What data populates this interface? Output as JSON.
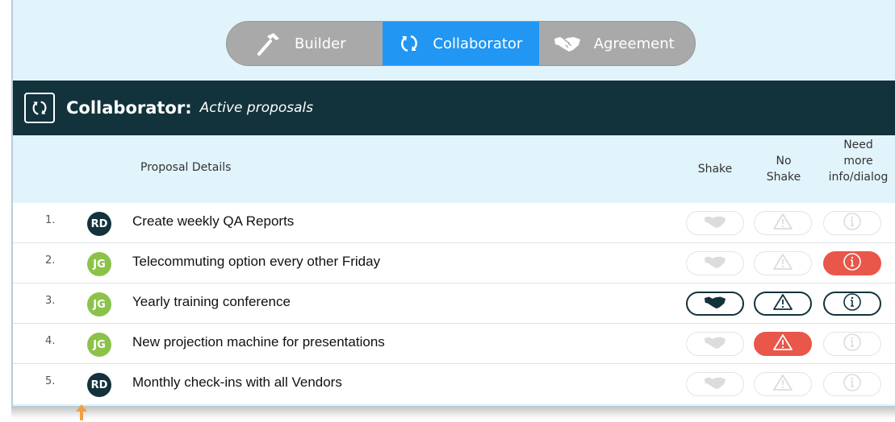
{
  "toolbar": {
    "tabs": [
      {
        "label": "Builder",
        "icon": "hammer-icon",
        "selected": false
      },
      {
        "label": "Collaborator",
        "icon": "sync-icon",
        "selected": true
      },
      {
        "label": "Agreement",
        "icon": "handshake-icon",
        "selected": false
      }
    ]
  },
  "header": {
    "title": "Collaborator:",
    "subtitle": "Active proposals",
    "icon": "sync-icon"
  },
  "columns": {
    "details": "Proposal Details",
    "shake": "Shake",
    "no_shake_1": "No",
    "no_shake_2": "Shake",
    "need_1": "Need",
    "need_2": "more",
    "need_3": "info/dialog"
  },
  "proposals": [
    {
      "num": "1.",
      "initials": "RD",
      "avatar_color": "#12323c",
      "text": "Create weekly QA Reports",
      "shake": "inactive",
      "no_shake": "inactive",
      "need_info": "inactive"
    },
    {
      "num": "2.",
      "initials": "JG",
      "avatar_color": "#8bc34a",
      "text": "Telecommuting option every other Friday",
      "shake": "inactive",
      "no_shake": "inactive",
      "need_info": "alert"
    },
    {
      "num": "3.",
      "initials": "JG",
      "avatar_color": "#8bc34a",
      "text": "Yearly training conference",
      "shake": "selected",
      "no_shake": "active",
      "need_info": "active"
    },
    {
      "num": "4.",
      "initials": "JG",
      "avatar_color": "#8bc34a",
      "text": "New projection machine for presentations",
      "shake": "inactive",
      "no_shake": "alert",
      "need_info": "inactive"
    },
    {
      "num": "5.",
      "initials": "RD",
      "avatar_color": "#12323c",
      "text": "Monthly check-ins with all Vendors",
      "shake": "inactive",
      "no_shake": "inactive",
      "need_info": "inactive"
    }
  ],
  "colors": {
    "accent": "#2196f3",
    "header_bg": "#12323c",
    "panel_bg": "#e1f4fb",
    "alert": "#e8574a",
    "avatar_green": "#8bc34a"
  }
}
